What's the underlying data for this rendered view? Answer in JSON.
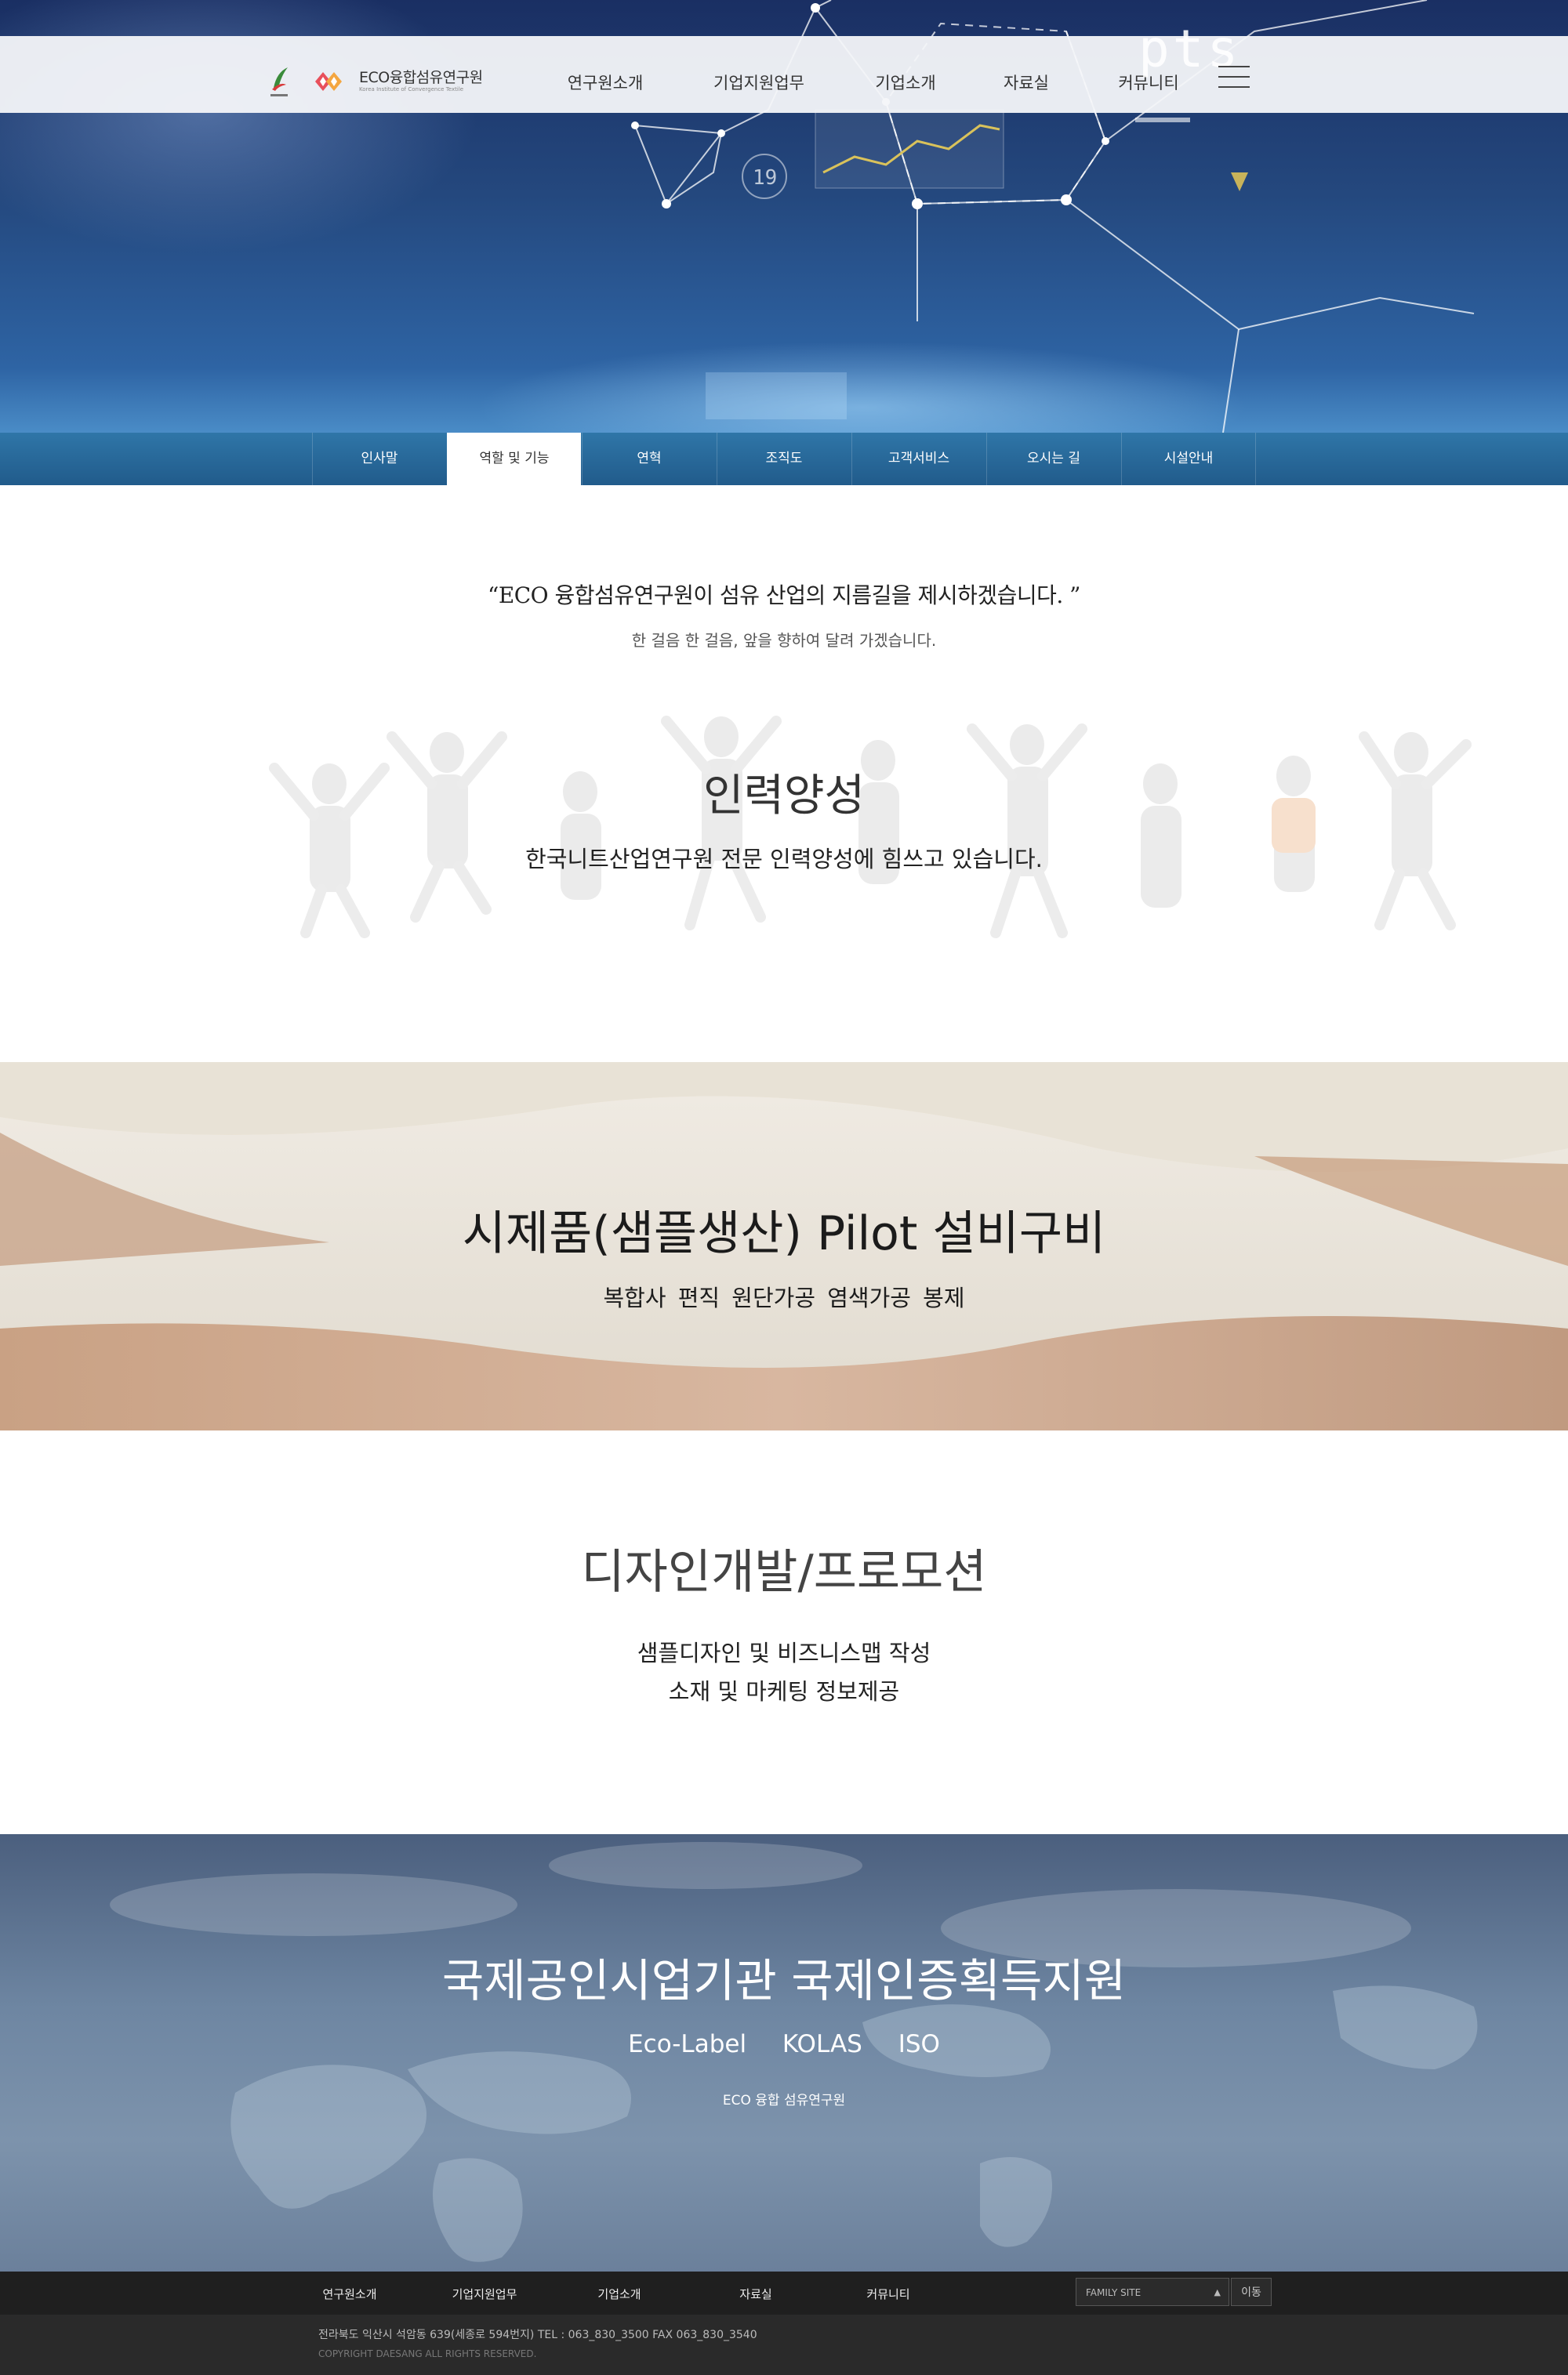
{
  "header": {
    "logo_title": "ECO융합섬유연구원",
    "logo_sub": "Korea Institute of Convergence Textile",
    "nav": [
      "연구원소개",
      "기업지원업무",
      "기업소개",
      "자료실",
      "커뮤니티"
    ],
    "deco_text": "pts"
  },
  "subnav": {
    "items": [
      "인사말",
      "역할 및 기능",
      "연혁",
      "조직도",
      "고객서비스",
      "오시는 길",
      "시설안내"
    ],
    "active": "역할 및 기능"
  },
  "quote": {
    "main": "“ECO 융합섬유연구원이 섬유 산업의 지름길을 제시하겠습니다. ”",
    "sub": "한 걸음 한 걸음,  앞을 향하여 달려 가겠습니다."
  },
  "section_people": {
    "title": "인력양성",
    "desc": "한국니트산업연구원 전문 인력양성에 힘쓰고 있습니다."
  },
  "section_fabric": {
    "title": "시제품(샘플생산) Pilot 설비구비",
    "desc": "복합사  편직  원단가공  염색가공   봉제"
  },
  "section_design": {
    "title": "디자인개발/프로모션",
    "line1": "샘플디자인 및 비즈니스맵 작성",
    "line2": "소재 및 마케팅 정보제공"
  },
  "section_world": {
    "title": "국제공인시업기관 국제인증획득지원",
    "labels": [
      "Eco-Label",
      "KOLAS",
      "ISO"
    ],
    "org": "ECO 융합 섬유연구원"
  },
  "footer": {
    "nav": [
      "연구원소개",
      "기업지원업무",
      "기업소개",
      "자료실",
      "커뮤니티"
    ],
    "family_site": "FAMILY SITE",
    "go_button": "이동",
    "address": "전라북도 익산시 석암동 639(세종로 594번지)   TEL : 063_830_3500    FAX   063_830_3540",
    "copyright": "COPYRIGHT DAESANG ALL RIGHTS RESERVED."
  },
  "colors": {
    "subnav_bg": "#2f76a8",
    "footer_bg": "#1f1f1f",
    "hero_bg": "#24487e"
  }
}
